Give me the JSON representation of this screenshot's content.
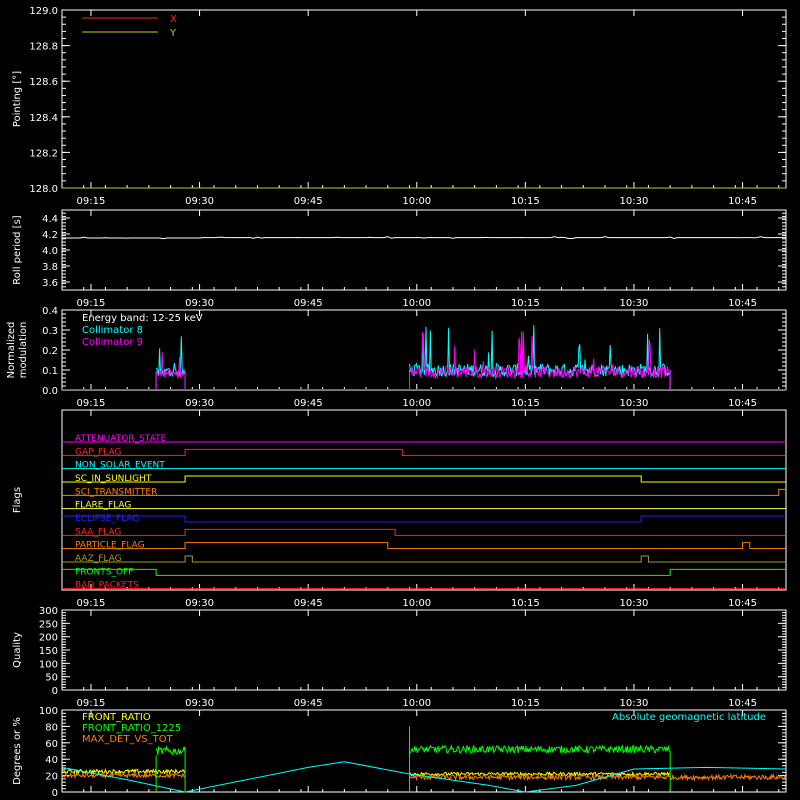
{
  "colors": {
    "background": "#000000",
    "axes": "#ffffff",
    "x": "#ff2020",
    "y": "#c8c820",
    "cyan": "#00ffff",
    "magenta": "#ff00ff",
    "green": "#00ff00",
    "orange": "#ff8000",
    "yellow": "#ffff00"
  },
  "chart_data": [
    {
      "type": "line",
      "id": "pointing",
      "ylabel": "Pointing [°]",
      "ylim": [
        128.0,
        129.0
      ],
      "yticks": [
        "128.0",
        "128.2",
        "128.4",
        "128.6",
        "128.8",
        "129.0"
      ],
      "xticks": [
        "09:15",
        "09:30",
        "09:45",
        "10:00",
        "10:15",
        "10:30",
        "10:45"
      ],
      "xlim": [
        "09:11",
        "10:51"
      ],
      "series": [
        {
          "name": "X",
          "color": "#ff2020",
          "x": [
            "09:11",
            "10:51"
          ],
          "y": [
            128.0,
            128.0
          ]
        },
        {
          "name": "Y",
          "color": "#c8c820",
          "x": [
            "09:11",
            "10:51"
          ],
          "y": [
            128.0,
            128.0
          ]
        }
      ]
    },
    {
      "type": "line",
      "id": "roll",
      "ylabel": "Roll period [s]",
      "ylim": [
        3.5,
        4.5
      ],
      "yticks": [
        "3.6",
        "3.8",
        "4.0",
        "4.2",
        "4.4"
      ],
      "xticks": [
        "09:15",
        "09:30",
        "09:45",
        "10:00",
        "10:15",
        "10:30",
        "10:45"
      ],
      "series": [
        {
          "color": "#ffffff",
          "x": [
            "09:11",
            "09:20",
            "09:30",
            "09:40",
            "09:50",
            "10:00",
            "10:10",
            "10:20",
            "10:30",
            "10:40",
            "10:51"
          ],
          "y": [
            4.15,
            4.15,
            4.15,
            4.16,
            4.16,
            4.17,
            4.16,
            4.16,
            4.16,
            4.16,
            4.15
          ]
        }
      ]
    },
    {
      "type": "line",
      "id": "modulation",
      "ylabel": [
        "Normalized",
        "modulation"
      ],
      "annotation": "Energy band: 12-25 keV",
      "ylim": [
        0.0,
        0.4
      ],
      "yticks": [
        "0.0",
        "0.1",
        "0.2",
        "0.3",
        "0.4"
      ],
      "xticks": [
        "09:15",
        "09:30",
        "09:45",
        "10:00",
        "10:15",
        "10:30",
        "10:45"
      ],
      "series": [
        {
          "name": "Collimator 8",
          "color": "#00ffff",
          "segments": [
            {
              "start": "09:24",
              "end": "09:28",
              "base": 0.09,
              "noise": 0.1
            },
            {
              "start": "09:59",
              "end": "10:35",
              "base": 0.1,
              "noise": 0.13
            }
          ]
        },
        {
          "name": "Collimator 9",
          "color": "#ff00ff",
          "segments": [
            {
              "start": "09:24",
              "end": "09:28",
              "base": 0.08,
              "noise": 0.08
            },
            {
              "start": "09:59",
              "end": "10:35",
              "base": 0.09,
              "noise": 0.12
            }
          ]
        }
      ]
    },
    {
      "type": "line",
      "id": "flags",
      "ylabel": "Flags",
      "xticks": [
        "09:15",
        "09:30",
        "09:45",
        "10:00",
        "10:15",
        "10:30",
        "10:45"
      ],
      "flags": [
        {
          "name": "ATTENUATOR_STATE",
          "color": "#ff00ff",
          "steps": [
            [
              "09:11",
              0
            ]
          ]
        },
        {
          "name": "GAP_FLAG",
          "color": "#ff2020",
          "steps": [
            [
              "09:11",
              0
            ],
            [
              "09:28",
              1
            ],
            [
              "09:58",
              0
            ]
          ]
        },
        {
          "name": "NON_SOLAR_EVENT",
          "color": "#00ffff",
          "steps": [
            [
              "09:11",
              0
            ]
          ]
        },
        {
          "name": "SC_IN_SUNLIGHT",
          "color": "#ffff00",
          "steps": [
            [
              "09:11",
              0
            ],
            [
              "09:28",
              1
            ],
            [
              "10:31",
              0
            ]
          ]
        },
        {
          "name": "SCI_TRANSMITTER",
          "color": "#ff8000",
          "steps": [
            [
              "09:11",
              0
            ],
            [
              "10:50",
              1
            ]
          ]
        },
        {
          "name": "FLARE_FLAG",
          "color": "#ffff40",
          "steps": [
            [
              "09:11",
              0
            ]
          ]
        },
        {
          "name": "ECLIPSE_FLAG",
          "color": "#2020ff",
          "steps": [
            [
              "09:11",
              1
            ],
            [
              "09:28",
              0
            ],
            [
              "10:31",
              1
            ]
          ]
        },
        {
          "name": "SAA_FLAG",
          "color": "#ff2020",
          "steps": [
            [
              "09:11",
              0
            ],
            [
              "09:28",
              1
            ],
            [
              "09:57",
              0
            ]
          ]
        },
        {
          "name": "PARTICLE_FLAG",
          "color": "#ff8000",
          "steps": [
            [
              "09:11",
              0
            ],
            [
              "09:28",
              1
            ],
            [
              "09:56",
              0
            ],
            [
              "10:45",
              1
            ],
            [
              "10:46",
              0
            ]
          ]
        },
        {
          "name": "AAZ_FLAG",
          "color": "#a0a020",
          "steps": [
            [
              "09:11",
              0
            ],
            [
              "09:28",
              1
            ],
            [
              "09:29",
              0
            ],
            [
              "10:31",
              1
            ],
            [
              "10:32",
              0
            ]
          ]
        },
        {
          "name": "FRONTS_OFF",
          "color": "#00ff00",
          "steps": [
            [
              "09:11",
              1
            ],
            [
              "09:24",
              0
            ],
            [
              "10:35",
              1
            ]
          ]
        },
        {
          "name": "BAD_PACKETS",
          "color": "#ff2020",
          "steps": [
            [
              "09:11",
              0
            ]
          ]
        }
      ]
    },
    {
      "type": "line",
      "id": "quality",
      "ylabel": "Quality",
      "ylim": [
        0,
        300
      ],
      "yticks": [
        "0",
        "50",
        "100",
        "150",
        "200",
        "250",
        "300"
      ],
      "xticks": [
        "09:15",
        "09:30",
        "09:45",
        "10:00",
        "10:15",
        "10:30",
        "10:45"
      ],
      "series": []
    },
    {
      "type": "line",
      "id": "ratios",
      "ylabel": "Degrees or %",
      "ylim": [
        0,
        100
      ],
      "yticks": [
        "0",
        "20",
        "40",
        "60",
        "80",
        "100"
      ],
      "annotation": "Absolute geomagnetic latitude",
      "series": [
        {
          "name": "FRONT_RATIO",
          "color": "#ffff00",
          "segments": [
            {
              "start": "09:11",
              "end": "09:28",
              "base": 25,
              "noise": 10
            },
            {
              "start": "09:59",
              "end": "10:35",
              "base": 22,
              "noise": 8
            }
          ]
        },
        {
          "name": "FRONT_RATIO_1225",
          "color": "#00ff00",
          "segments": [
            {
              "start": "09:24",
              "end": "09:28",
              "base": 50,
              "noise": 20
            },
            {
              "start": "09:59",
              "end": "10:35",
              "base": 52,
              "noise": 18
            }
          ]
        },
        {
          "name": "MAX_DET_VS_TOT",
          "color": "#ff8000",
          "segments": [
            {
              "start": "09:11",
              "end": "09:28",
              "base": 20,
              "noise": 10
            },
            {
              "start": "09:59",
              "end": "10:51",
              "base": 18,
              "noise": 12
            }
          ]
        },
        {
          "name": "Absolute geomagnetic latitude",
          "color": "#00ffff",
          "x": [
            "09:11",
            "09:20",
            "09:28",
            "09:45",
            "09:50",
            "09:59",
            "10:10",
            "10:15",
            "10:22",
            "10:30",
            "10:40",
            "10:51"
          ],
          "y": [
            30,
            15,
            0,
            30,
            37,
            22,
            8,
            0,
            8,
            28,
            30,
            28
          ]
        }
      ]
    }
  ]
}
